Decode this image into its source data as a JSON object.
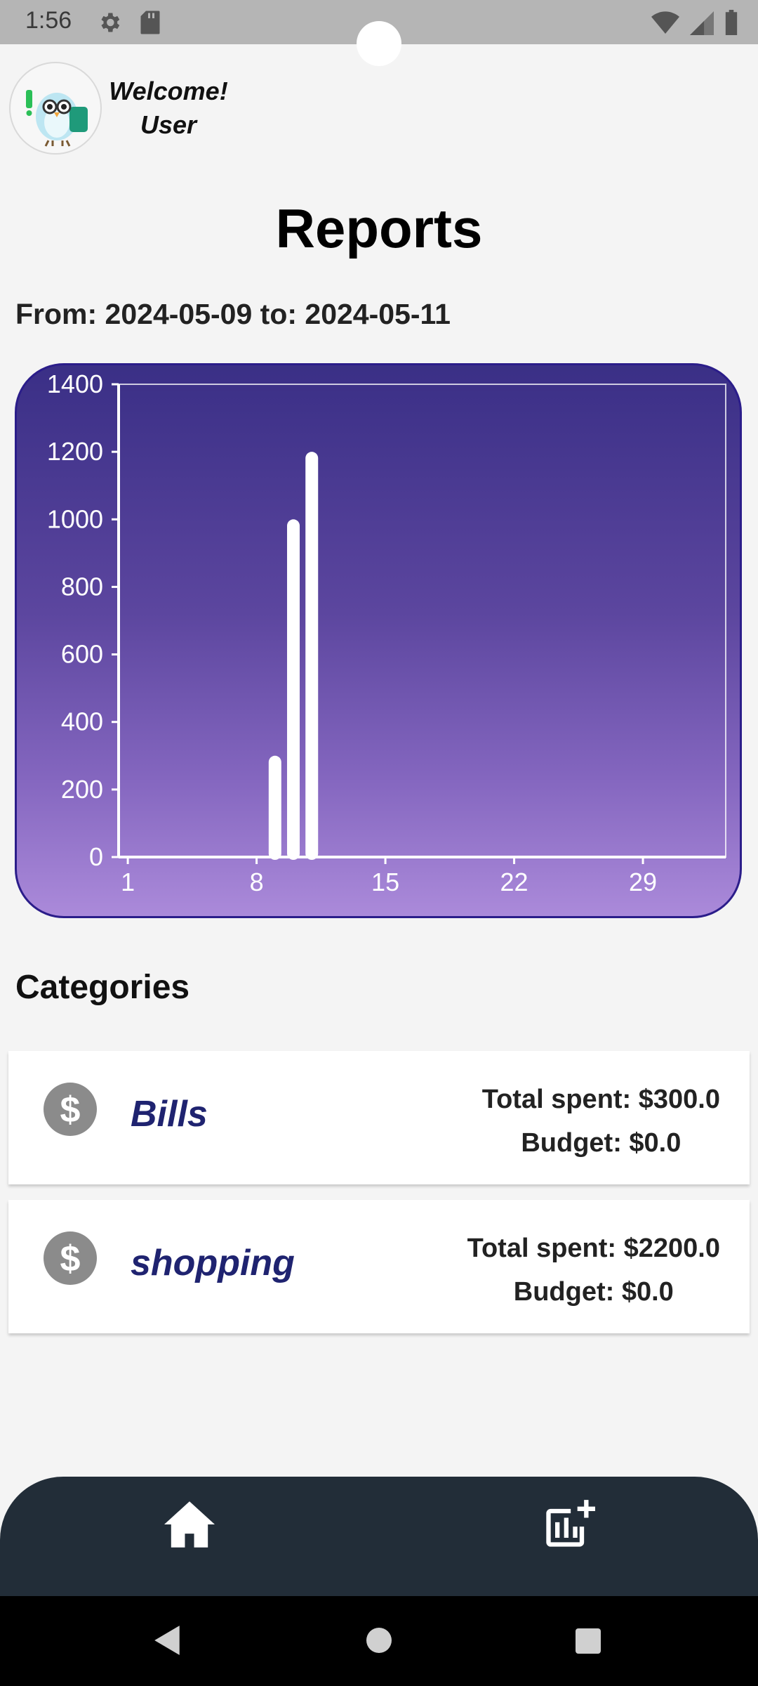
{
  "status_bar": {
    "time": "1:56"
  },
  "header": {
    "welcome_line1": "Welcome!",
    "welcome_line2": "User"
  },
  "page": {
    "title": "Reports",
    "date_range": "From: 2024-05-09 to: 2024-05-11"
  },
  "chart_data": {
    "type": "bar",
    "title": "",
    "xlabel": "",
    "ylabel": "",
    "x_ticks": [
      1,
      8,
      15,
      22,
      29
    ],
    "y_ticks": [
      0,
      200,
      400,
      600,
      800,
      1000,
      1200,
      1400
    ],
    "xlim": [
      0.5,
      33.5
    ],
    "ylim": [
      0,
      1400
    ],
    "x": [
      9,
      10,
      11
    ],
    "values": [
      300,
      1000,
      1200
    ],
    "bar_color": "#ffffff"
  },
  "categories_section": {
    "title": "Categories",
    "items": [
      {
        "name": "Bills",
        "total_spent": "Total spent: $300.0",
        "budget": "Budget: $0.0"
      },
      {
        "name": "shopping",
        "total_spent": "Total spent: $2200.0",
        "budget": "Budget: $0.0"
      }
    ]
  },
  "bottom_nav": {
    "items": [
      "home-icon",
      "add-chart-icon"
    ]
  },
  "colors": {
    "accent_dark": "#222d38",
    "category_text": "#1f2370",
    "chart_top": "#3a2f86",
    "chart_bottom": "#ab8ada"
  }
}
